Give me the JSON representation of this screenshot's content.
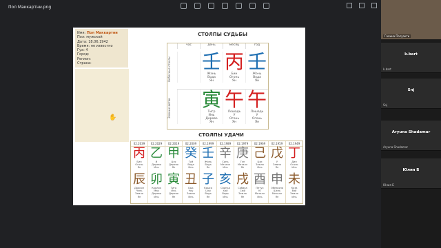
{
  "window": {
    "title": "Пол Маккартни.png"
  },
  "toolbar": {
    "icons": [
      "crop-icon",
      "edit-icon",
      "rotate-icon",
      "delete-icon",
      "print-icon",
      "settings-icon",
      "more-icon"
    ]
  },
  "info": {
    "name_label": "Имя:",
    "name_value": "Пол Маккартни",
    "gender": "Пол: мужской",
    "date": "Дата: 18.06.1942",
    "time": "Время: не известно",
    "gua": "Гуа: 4",
    "city": "Город:",
    "region": "Регион:",
    "country": "Страна:"
  },
  "destiny": {
    "title": "СТОЛПЫ СУДЬБЫ",
    "headers": [
      "час",
      "день",
      "месяц",
      "год"
    ],
    "row1_label": "Небесные стволы",
    "row2_label": "Земные ветви",
    "stems": [
      {
        "glyph": "",
        "sub": ""
      },
      {
        "glyph": "壬",
        "sub": "Жэнь\nВода\nЯн",
        "color": "#1f6fb2"
      },
      {
        "glyph": "丙",
        "sub": "Бин\nОгонь\nЯн",
        "color": "#d42020"
      },
      {
        "glyph": "壬",
        "sub": "Жэнь\nВода\nЯн",
        "color": "#1f6fb2"
      }
    ],
    "branches": [
      {
        "glyph": "",
        "sub": ""
      },
      {
        "glyph": "寅",
        "sub": "Тигр\nИнь\nДерево\nЯн",
        "color": "#2a8a3a"
      },
      {
        "glyph": "午",
        "sub": "Лошадь\nУ\nОгонь\nЯн",
        "color": "#d42020"
      },
      {
        "glyph": "午",
        "sub": "Лошадь\nУ\nОгонь\nЯн",
        "color": "#d42020"
      }
    ]
  },
  "luck": {
    "title": "СТОЛПЫ УДАЧИ",
    "columns": [
      {
        "year": "02.2039",
        "stem": "丙",
        "sc": "#d42020",
        "ss": "Бин\nОгонь\nЯн",
        "branch": "辰",
        "bc": "#8b5a2b",
        "bs": "Дракон\nЧэнь\nЗемля\nЯн"
      },
      {
        "year": "02.2029",
        "stem": "乙",
        "sc": "#2a8a3a",
        "ss": "И\nДерево\nИнь",
        "branch": "卯",
        "bc": "#2a8a3a",
        "bs": "Кролик\nМао\nДерево\nИнь"
      },
      {
        "year": "02.2019",
        "stem": "甲",
        "sc": "#2a8a3a",
        "ss": "Цзя\nДерево\nЯн",
        "branch": "寅",
        "bc": "#2a8a3a",
        "bs": "Тигр\nИнь\nДерево\nЯн"
      },
      {
        "year": "02.2009",
        "stem": "癸",
        "sc": "#1f6fb2",
        "ss": "Гуй\nВода\nИнь",
        "branch": "丑",
        "bc": "#8b5a2b",
        "bs": "Бык\nЧоу\nЗемля\nИнь"
      },
      {
        "year": "02.1999",
        "stem": "壬",
        "sc": "#1f6fb2",
        "ss": "Жэнь\nВода\nЯн",
        "branch": "子",
        "bc": "#1f6fb2",
        "bs": "Крыса\nЦзы\nВода\nЯн"
      },
      {
        "year": "02.1989",
        "stem": "辛",
        "sc": "#777777",
        "ss": "Синь\nМеталл\nИнь",
        "branch": "亥",
        "bc": "#1f6fb2",
        "bs": "Свинья\nХай\nВода\nИнь"
      },
      {
        "year": "02.1979",
        "stem": "庚",
        "sc": "#777777",
        "ss": "Гэн\nМеталл\nЯн",
        "branch": "戌",
        "bc": "#8b5a2b",
        "bs": "Собака\nСюй\nЗемля\nЯн"
      },
      {
        "year": "02.1969",
        "stem": "己",
        "sc": "#8b5a2b",
        "ss": "Цзи\nЗемля\nИнь",
        "branch": "酉",
        "bc": "#777777",
        "bs": "Петух\nЮ\nМеталл\nИнь"
      },
      {
        "year": "02.1959",
        "stem": "戊",
        "sc": "#8b5a2b",
        "ss": "У\nЗемля\nЯн",
        "branch": "申",
        "bc": "#777777",
        "bs": "Обезьяна\nШэнь\nМеталл\nЯн"
      },
      {
        "year": "02.1949",
        "stem": "丁",
        "sc": "#d42020",
        "ss": "Дин\nОгонь\nИнь",
        "branch": "未",
        "bc": "#8b5a2b",
        "bs": "Коза\nВэй\nЗемля\nИнь"
      }
    ]
  },
  "participants": [
    {
      "name": "Галина Полуэкти",
      "self": true
    },
    {
      "name": "k.bart",
      "small": "k.bart"
    },
    {
      "name": "Snj",
      "small": "Snj"
    },
    {
      "name": "Aryuna Shadamar",
      "small": "Aryuna Shadamar"
    },
    {
      "name": "Юлия Б",
      "small": "Юлия Б"
    }
  ]
}
